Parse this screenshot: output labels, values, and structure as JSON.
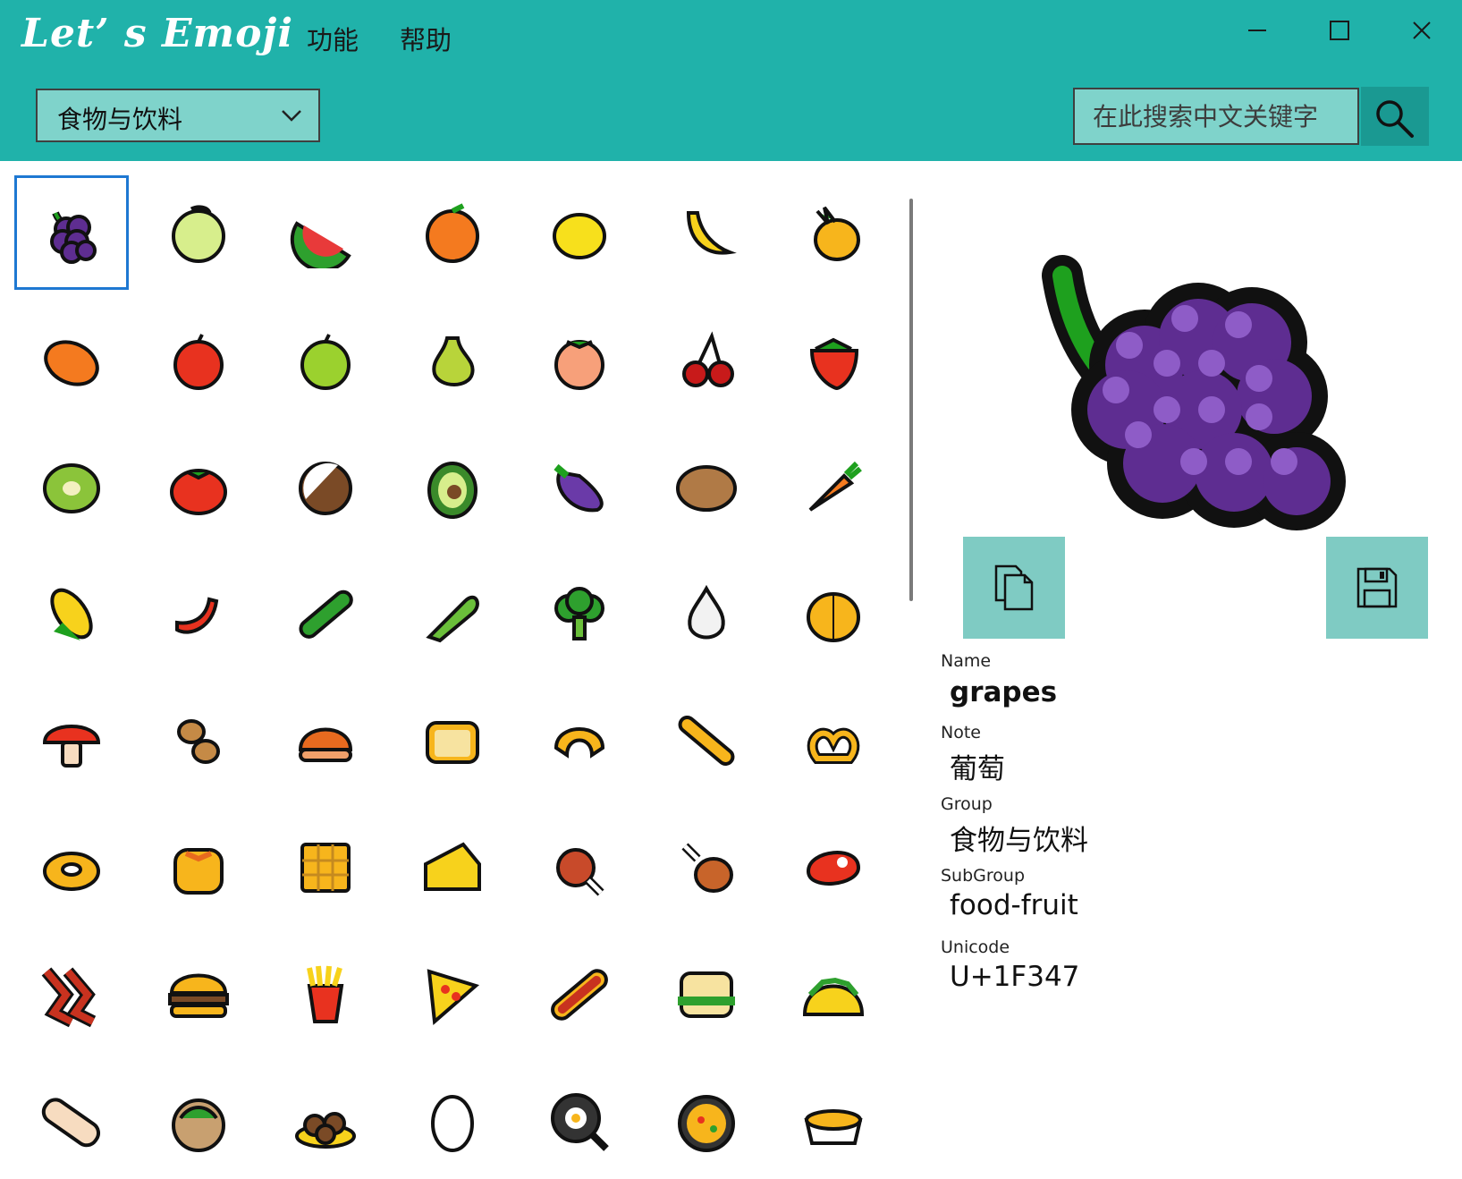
{
  "app": {
    "title": "Let’ s Emoji"
  },
  "menu": {
    "items": [
      "功能",
      "帮助"
    ]
  },
  "toolbar": {
    "category": "食物与饮料",
    "search_placeholder": "在此搜索中文关键字"
  },
  "colors": {
    "header": "#20b2aa",
    "control": "#7fd3cb",
    "search_button": "#1a9992",
    "selection": "#1e78d2",
    "action_button": "#7fcbc3"
  },
  "grid": {
    "columns": 7,
    "selected_index": 0,
    "items": [
      "grapes",
      "melon",
      "watermelon",
      "tangerine",
      "lemon",
      "banana",
      "pineapple",
      "mango",
      "red-apple",
      "green-apple",
      "pear",
      "peach",
      "cherries",
      "strawberry",
      "kiwi",
      "tomato",
      "coconut",
      "avocado",
      "eggplant",
      "potato",
      "carrot",
      "corn",
      "hot-pepper",
      "cucumber",
      "leafy-green",
      "broccoli",
      "garlic",
      "onion",
      "mushroom",
      "peanuts",
      "chestnut",
      "bread",
      "croissant",
      "baguette",
      "pretzel",
      "bagel",
      "pancakes",
      "waffle",
      "cheese",
      "meat-on-bone",
      "poultry-leg",
      "cut-of-meat",
      "bacon",
      "hamburger",
      "french-fries",
      "pizza",
      "hot-dog",
      "sandwich",
      "taco",
      "burrito",
      "stuffed-flatbread",
      "falafel",
      "egg",
      "cooking",
      "shallow-pan-of-food",
      "pot-of-food"
    ]
  },
  "details": {
    "name_label": "Name",
    "name": "grapes",
    "note_label": "Note",
    "note": "葡萄",
    "group_label": "Group",
    "group": "食物与饮料",
    "subgroup_label": "SubGroup",
    "subgroup": "food-fruit",
    "unicode_label": "Unicode",
    "unicode": "U+1F347"
  },
  "actions": {
    "copy_icon": "copy-icon",
    "save_icon": "save-icon"
  }
}
